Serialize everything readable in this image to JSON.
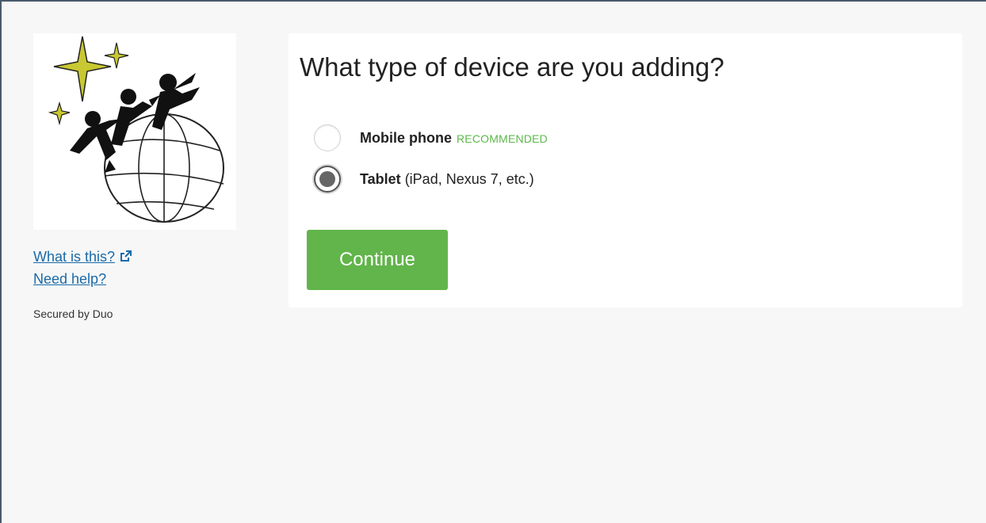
{
  "sidebar": {
    "links": [
      {
        "label": "What is this?",
        "icon": "external-link-icon"
      },
      {
        "label": "Need help?"
      }
    ],
    "secured_text": "Secured by Duo"
  },
  "main": {
    "question": "What type of device are you adding?",
    "options": [
      {
        "label": "Mobile phone",
        "badge": "RECOMMENDED",
        "selected": false
      },
      {
        "label": "Tablet",
        "detail": "(iPad, Nexus 7, etc.)",
        "selected": true
      }
    ],
    "continue_label": "Continue"
  },
  "colors": {
    "accent_green": "#61b54a",
    "link_blue": "#1a6aa8",
    "star_yellow": "#c8c832"
  }
}
